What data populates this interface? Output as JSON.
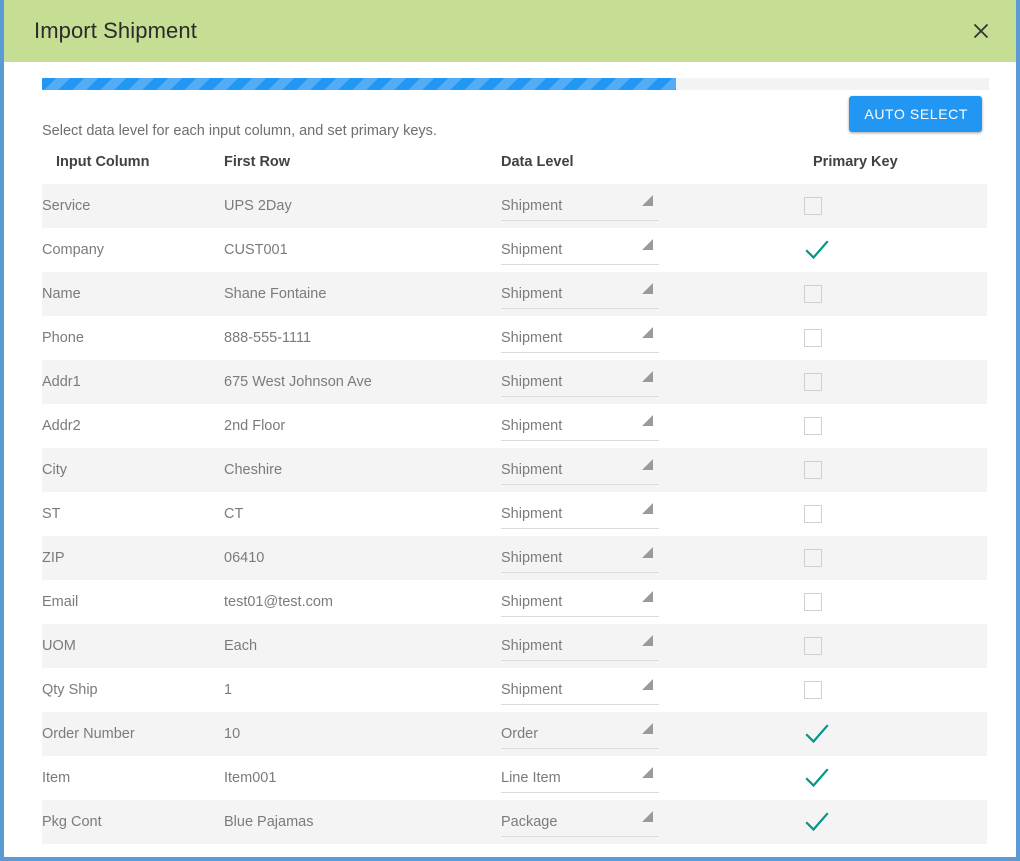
{
  "modal": {
    "title": "Import Shipment",
    "close_icon": "close-icon"
  },
  "progress": {
    "percent": 67,
    "accent_color": "#2196f3",
    "track_color": "#f3f3f3"
  },
  "instruction": {
    "text": "Select data level for each input column, and set primary keys.",
    "auto_select_label": "AUTO SELECT"
  },
  "colors": {
    "header_background": "#c6de93",
    "modal_border": "#5b9bd5",
    "accent_blue": "#2196f3",
    "check_teal": "#009688",
    "row_alt": "#f4f4f4"
  },
  "table": {
    "headers": {
      "input_column": "Input Column",
      "first_row": "First Row",
      "data_level": "Data Level",
      "primary_key": "Primary Key"
    },
    "rows": [
      {
        "input_column": "Service",
        "first_row": "UPS 2Day",
        "data_level": "Shipment",
        "primary_key": false
      },
      {
        "input_column": "Company",
        "first_row": "CUST001",
        "data_level": "Shipment",
        "primary_key": true
      },
      {
        "input_column": "Name",
        "first_row": "Shane Fontaine",
        "data_level": "Shipment",
        "primary_key": false
      },
      {
        "input_column": "Phone",
        "first_row": "888-555-1111",
        "data_level": "Shipment",
        "primary_key": false
      },
      {
        "input_column": "Addr1",
        "first_row": "675 West Johnson Ave",
        "data_level": "Shipment",
        "primary_key": false
      },
      {
        "input_column": "Addr2",
        "first_row": "2nd Floor",
        "data_level": "Shipment",
        "primary_key": false
      },
      {
        "input_column": "City",
        "first_row": "Cheshire",
        "data_level": "Shipment",
        "primary_key": false
      },
      {
        "input_column": "ST",
        "first_row": "CT",
        "data_level": "Shipment",
        "primary_key": false
      },
      {
        "input_column": "ZIP",
        "first_row": "06410",
        "data_level": "Shipment",
        "primary_key": false
      },
      {
        "input_column": "Email",
        "first_row": "test01@test.com",
        "data_level": "Shipment",
        "primary_key": false
      },
      {
        "input_column": "UOM",
        "first_row": "Each",
        "data_level": "Shipment",
        "primary_key": false
      },
      {
        "input_column": "Qty Ship",
        "first_row": "1",
        "data_level": "Shipment",
        "primary_key": false
      },
      {
        "input_column": "Order Number",
        "first_row": "10",
        "data_level": "Order",
        "primary_key": true
      },
      {
        "input_column": "Item",
        "first_row": "Item001",
        "data_level": "Line Item",
        "primary_key": true
      },
      {
        "input_column": "Pkg Cont",
        "first_row": "Blue Pajamas",
        "data_level": "Package",
        "primary_key": true
      }
    ]
  }
}
